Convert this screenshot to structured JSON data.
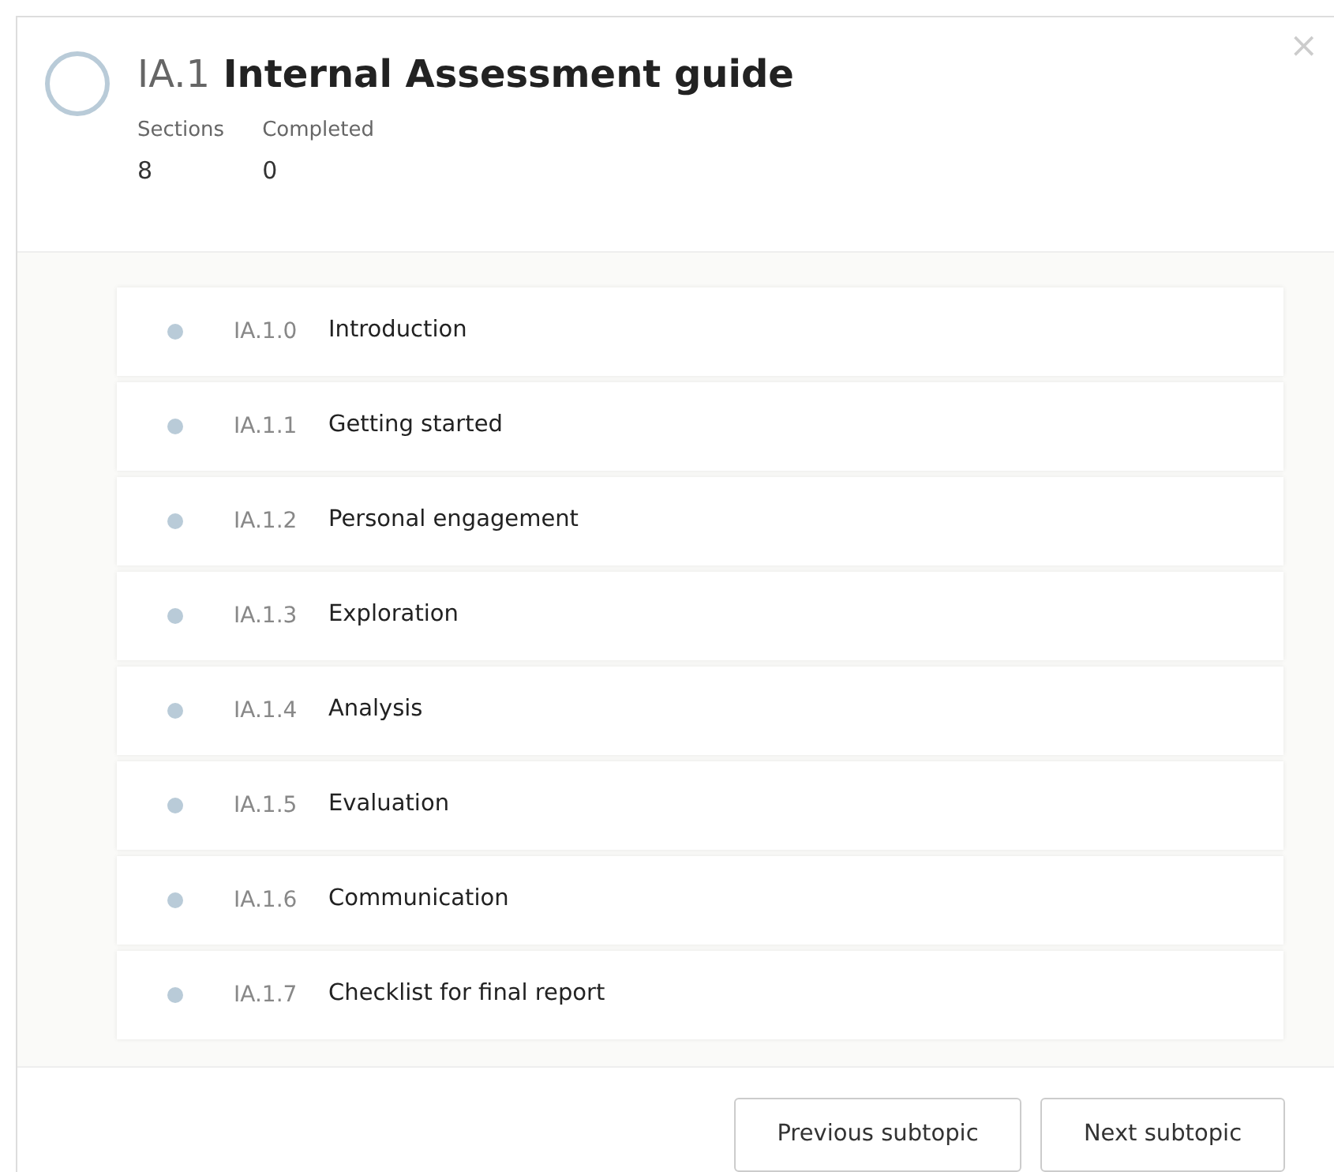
{
  "modal": {
    "code": "IA.1",
    "title": "Internal Assessment guide",
    "close": "×",
    "stats": [
      {
        "label": "Sections",
        "value": "8"
      },
      {
        "label": "Completed",
        "value": "0"
      }
    ]
  },
  "sections": [
    {
      "code": "IA.1.0",
      "title": "Introduction",
      "completed": false
    },
    {
      "code": "IA.1.1",
      "title": "Getting started",
      "completed": false
    },
    {
      "code": "IA.1.2",
      "title": "Personal engagement",
      "completed": false
    },
    {
      "code": "IA.1.3",
      "title": "Exploration",
      "completed": false
    },
    {
      "code": "IA.1.4",
      "title": "Analysis",
      "completed": false
    },
    {
      "code": "IA.1.5",
      "title": "Evaluation",
      "completed": false
    },
    {
      "code": "IA.1.6",
      "title": "Communication",
      "completed": false
    },
    {
      "code": "IA.1.7",
      "title": "Checklist for final report",
      "completed": false
    }
  ],
  "buttons": [
    "Previous subtopic",
    "Next subtopic"
  ]
}
